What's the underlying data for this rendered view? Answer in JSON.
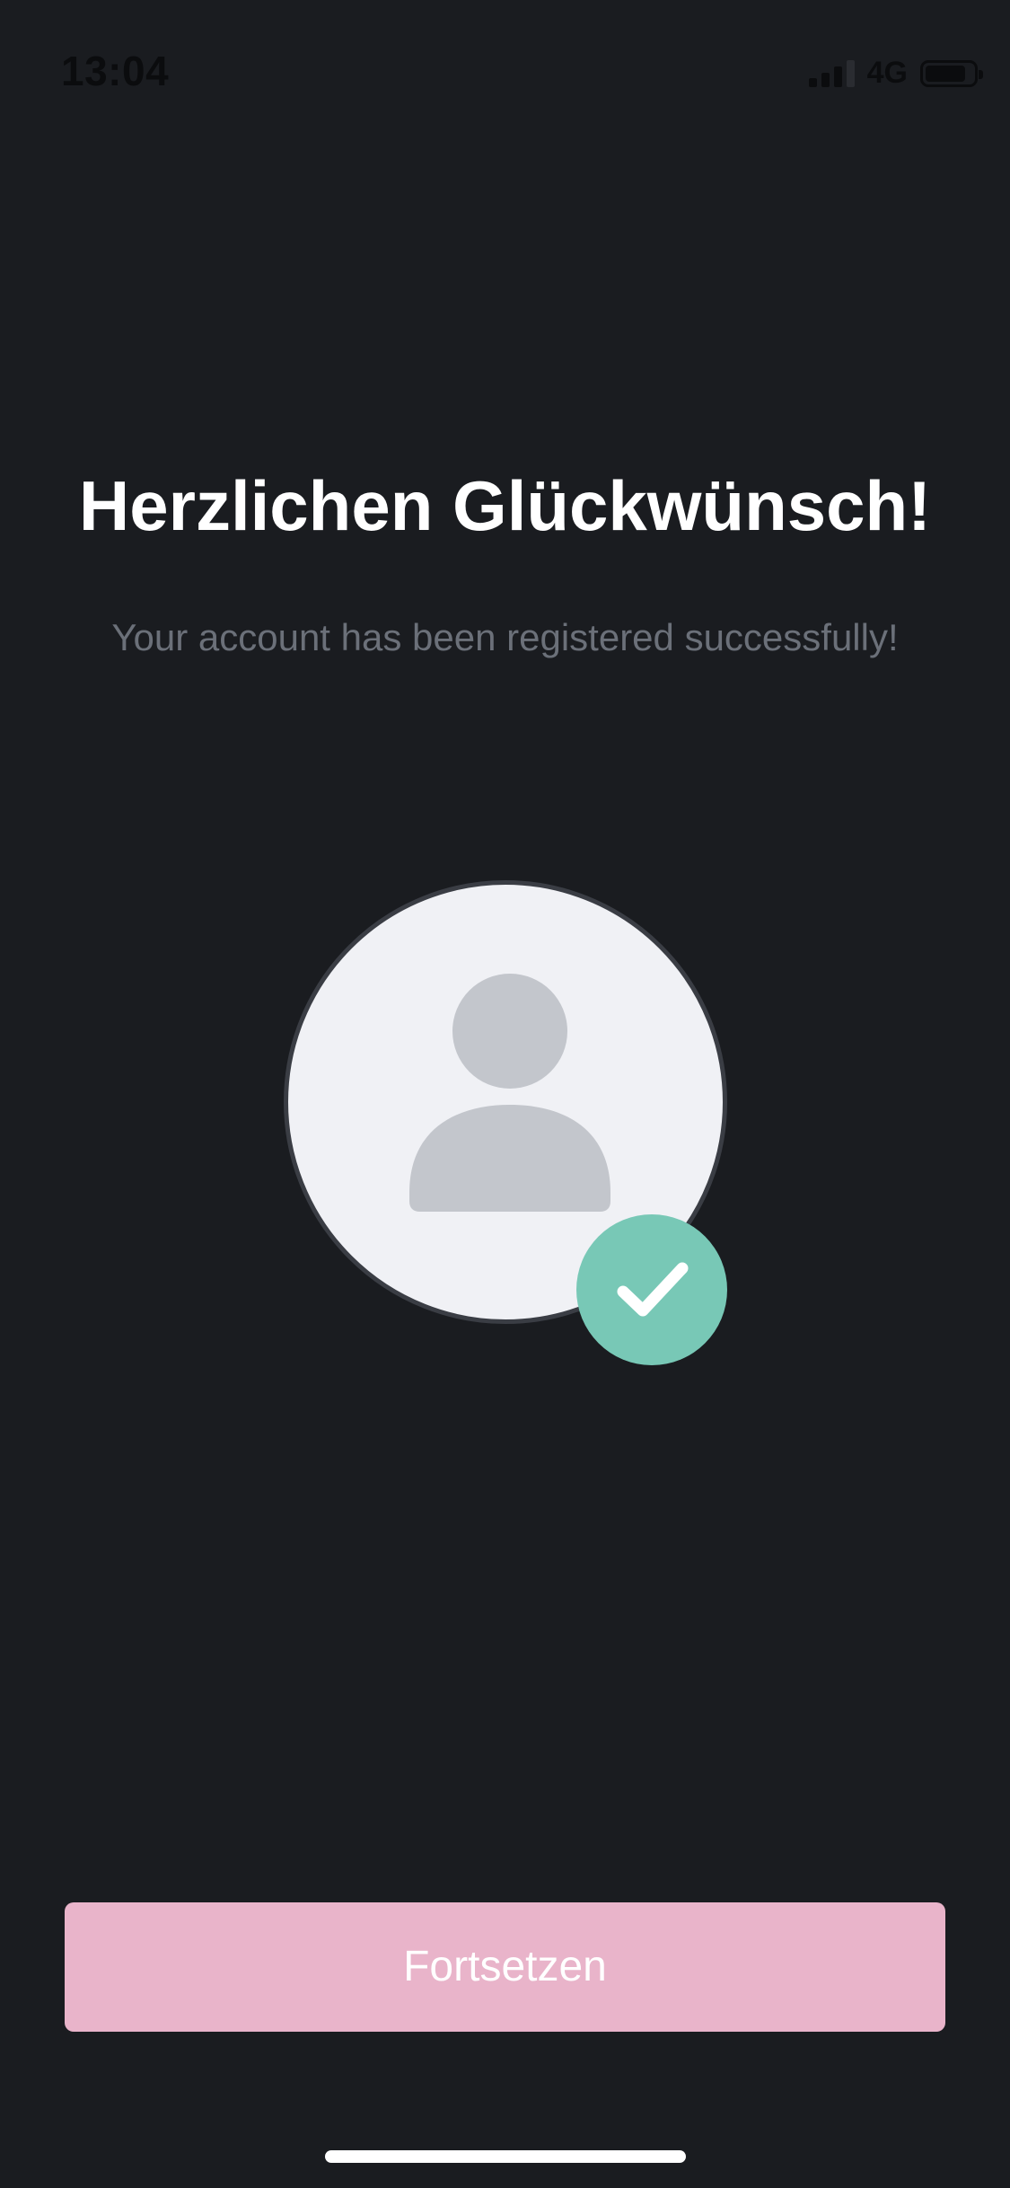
{
  "status_bar": {
    "time": "13:04",
    "network": "4G",
    "icons": [
      "signal-icon",
      "battery-icon"
    ]
  },
  "main": {
    "title": "Herzlichen Glückwünsch!",
    "subtitle": "Your account has been registered successfully!",
    "avatar_icon": "user-avatar-icon",
    "badge_icon": "checkmark-icon"
  },
  "footer": {
    "continue_label": "Fortsetzen"
  },
  "colors": {
    "background": "#1a1c20",
    "title": "#ffffff",
    "subtitle": "#6b7079",
    "avatar_bg": "#f0f1f5",
    "avatar_figure": "#c3c6cc",
    "badge": "#78c8b6",
    "button": "#e9b4ca"
  }
}
